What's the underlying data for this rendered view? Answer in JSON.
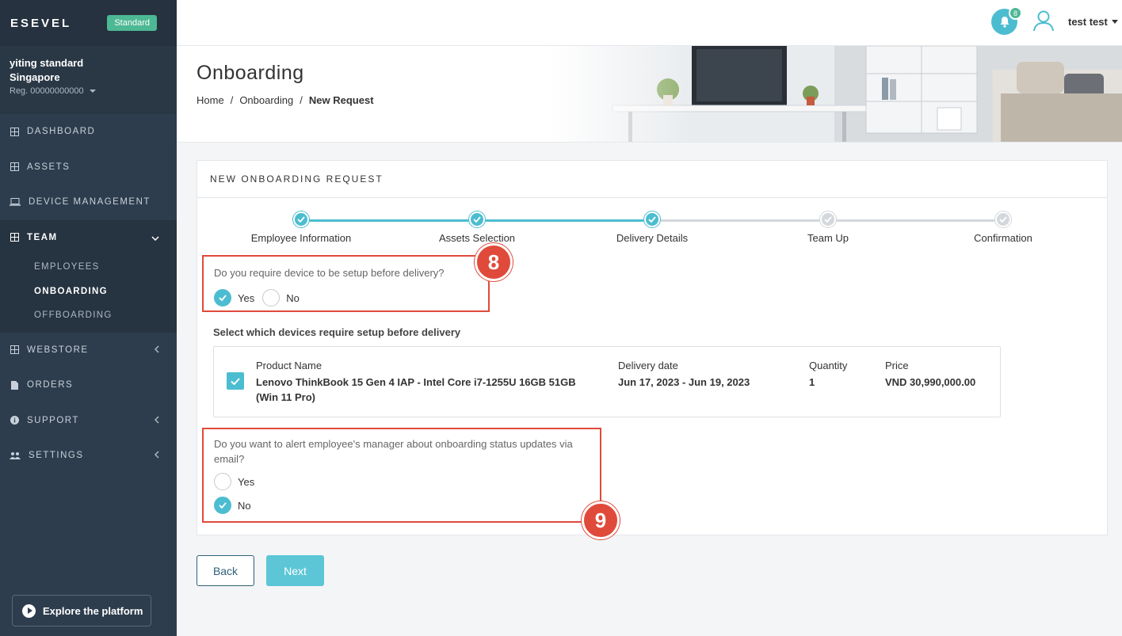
{
  "sidebar": {
    "logo": "ESEVEL",
    "plan": "Standard",
    "company_name": "yiting standard",
    "company_country": "Singapore",
    "reg": "Reg. 00000000000",
    "items": [
      {
        "label": "DASHBOARD",
        "icon": "grid-icon"
      },
      {
        "label": "ASSETS",
        "icon": "grid-icon"
      },
      {
        "label": "DEVICE MANAGEMENT",
        "icon": "laptop-icon"
      },
      {
        "label": "TEAM",
        "icon": "grid-icon",
        "expanded": true
      },
      {
        "label": "WEBSTORE",
        "icon": "grid-icon"
      },
      {
        "label": "ORDERS",
        "icon": "document-icon"
      },
      {
        "label": "SUPPORT",
        "icon": "info-icon"
      },
      {
        "label": "SETTINGS",
        "icon": "users-icon"
      }
    ],
    "team_sub": [
      "EMPLOYEES",
      "ONBOARDING",
      "OFFBOARDING"
    ],
    "explore_label": "Explore the platform"
  },
  "topbar": {
    "notification_count": "8",
    "user_name": "test test"
  },
  "header": {
    "title": "Onboarding",
    "breadcrumb": [
      "Home",
      "Onboarding",
      "New Request"
    ],
    "separator": "/"
  },
  "card": {
    "title": "NEW ONBOARDING REQUEST",
    "steps": [
      {
        "label": "Employee Information",
        "done": true
      },
      {
        "label": "Assets Selection",
        "done": true
      },
      {
        "label": "Delivery Details",
        "done": true
      },
      {
        "label": "Team Up",
        "done": false
      },
      {
        "label": "Confirmation",
        "done": false
      }
    ],
    "q1": {
      "question": "Do you require device to be setup before delivery?",
      "yes": "Yes",
      "no": "No",
      "selected": "Yes",
      "annotation": "8"
    },
    "select_title": "Select which devices require setup before delivery",
    "device": {
      "product_header": "Product Name",
      "product": "Lenovo ThinkBook 15 Gen 4 IAP - Intel Core i7-1255U 16GB 51GB (Win 11 Pro)",
      "delivery_header": "Delivery date",
      "delivery": "Jun 17, 2023 - Jun 19, 2023",
      "quantity_header": "Quantity",
      "quantity": "1",
      "price_header": "Price",
      "price": "VND 30,990,000.00",
      "checked": true
    },
    "q2": {
      "question": "Do you want to alert employee's manager about onboarding status updates via email?",
      "yes": "Yes",
      "no": "No",
      "selected": "No",
      "annotation": "9"
    }
  },
  "buttons": {
    "back": "Back",
    "next": "Next"
  },
  "colors": {
    "accent": "#4cbdd0",
    "sidebar": "#2e3d4d",
    "highlight": "#e04a3a",
    "plan_badge": "#4db894"
  }
}
